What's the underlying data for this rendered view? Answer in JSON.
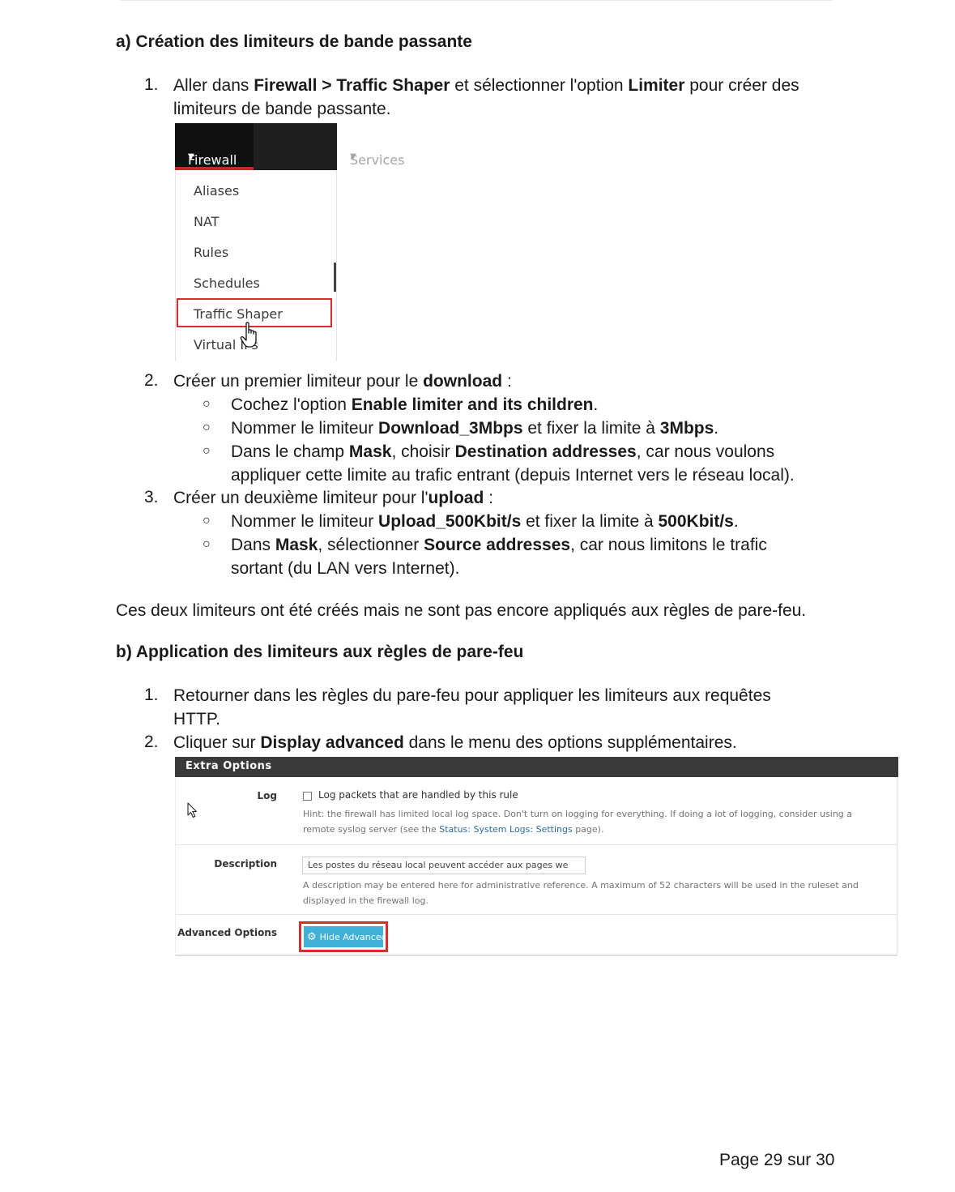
{
  "section_a": {
    "title": "a) Création des limiteurs de bande passante",
    "step1": {
      "num": "1.",
      "pre": "Aller dans ",
      "b1": "Firewall > Traffic Shaper",
      "mid": " et sélectionner l'option ",
      "b2": "Limiter",
      "post": " pour créer des",
      "line2": "limiteurs de bande passante."
    },
    "menu": {
      "firewall_label": "Firewall",
      "services_label": "Services",
      "items": [
        "Aliases",
        "NAT",
        "Rules",
        "Schedules",
        "Traffic Shaper",
        "Virtual IPs"
      ]
    },
    "step2": {
      "num": "2.",
      "pre": "Créer un premier limiteur pour le ",
      "b": "download",
      "post": " :",
      "bullets": {
        "b1": {
          "pre": "Cochez l'option ",
          "b": "Enable limiter and its children",
          "post": "."
        },
        "b2": {
          "pre": "Nommer le limiteur ",
          "b1": "Download_3Mbps",
          "mid": " et fixer la limite à ",
          "b2": "3Mbps",
          "post": "."
        },
        "b3": {
          "pre": "Dans le champ ",
          "b1": "Mask",
          "mid": ", choisir ",
          "b2": "Destination addresses",
          "post": ", car nous voulons",
          "line2": "appliquer cette limite au trafic entrant (depuis Internet vers le réseau local)."
        }
      }
    },
    "step3": {
      "num": "3.",
      "pre": "Créer un deuxième limiteur pour l'",
      "b": "upload",
      "post": " :",
      "bullets": {
        "b1": {
          "pre": "Nommer le limiteur ",
          "b1": "Upload_500Kbit/s",
          "mid": " et fixer la limite à ",
          "b2": "500Kbit/s",
          "post": "."
        },
        "b2": {
          "pre": "Dans ",
          "b1": "Mask",
          "mid": ", sélectionner ",
          "b2": "Source addresses",
          "post": ", car nous limitons le trafic",
          "line2": "sortant (du LAN vers Internet)."
        }
      }
    },
    "bullet_glyph": "○"
  },
  "para": "Ces deux limiteurs ont été créés mais ne sont pas encore appliqués aux règles de pare-feu.",
  "section_b": {
    "title": "b) Application des limiteurs aux règles de pare-feu",
    "step1": {
      "num": "1.",
      "line1": "Retourner dans les règles du pare-feu pour appliquer les limiteurs aux requêtes",
      "line2": "HTTP."
    },
    "step2": {
      "num": "2.",
      "pre": "Cliquer sur ",
      "b": "Display advanced",
      "post": " dans le menu des options supplémentaires."
    }
  },
  "extra_options": {
    "header": "Extra Options",
    "log_label": "Log",
    "log_checkbox_text": "Log packets that are handled by this rule",
    "log_hint_1": "Hint: the firewall has limited local log space. Don't turn on logging for everything. If doing a lot of logging, consider using a",
    "log_hint_2_pre": "remote syslog server (see the ",
    "log_hint_link": "Status: System Logs: Settings",
    "log_hint_2_post": " page).",
    "description_label": "Description",
    "description_value": "Les postes du réseau local peuvent accéder aux pages we",
    "description_hint": "A description may be entered here for administrative reference. A maximum of 52 characters will be used in the ruleset and displayed in the firewall log.",
    "advanced_label": "Advanced Options",
    "advanced_button": "Hide Advanced"
  },
  "footer": "Page 29 sur 30"
}
